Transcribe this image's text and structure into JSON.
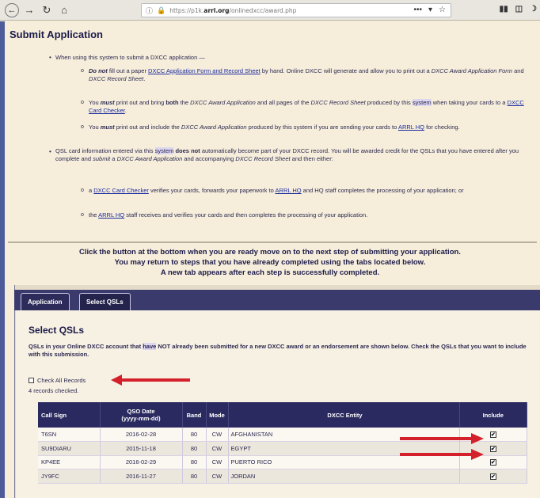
{
  "browser": {
    "url_prefix": "https://p1k.",
    "url_domain": "arrl.org",
    "url_suffix": "/onlinedxcc/award.php",
    "more_glyph": "•••",
    "pocket_glyph": "▾",
    "star_glyph": "☆"
  },
  "page_title": "Submit Application",
  "bullet1": {
    "intro": "When using this system to submit a DXCC application —",
    "sub1": {
      "em": "Do not",
      "t1": " fill out a paper ",
      "link": "DXCC Application Form and Record Sheet",
      "t2": " by hand. Online DXCC will generate and allow you to print out a ",
      "it1": "DXCC Award Application Form",
      "t3": " and ",
      "it2": "DXCC Record Sheet",
      "t4": "."
    },
    "sub2": {
      "t1": "You ",
      "em": "must",
      "t2": " print out and bring ",
      "bold": "both",
      "t3": " the ",
      "it1": "DXCC Award Application",
      "t4": " and all pages of the ",
      "it2": "DXCC Record Sheet",
      "t5": " produced by this ",
      "hl": "system",
      "t6": " when taking your cards to a ",
      "link": "DXCC Card Checker",
      "t7": "."
    },
    "sub3": {
      "t1": "You ",
      "em": "must",
      "t2": " print out and include the ",
      "it1": "DXCC Award Application",
      "t3": " produced by this system if you are sending your cards to ",
      "link": "ARRL HQ",
      "t4": " for checking."
    }
  },
  "bullet2": {
    "t1": "QSL card information entered via this ",
    "hl": "system",
    "bold": " does not",
    "t2": " automatically become part of your DXCC record. You will be awarded credit for the QSLs that you have entered after you complete and ",
    "it1": "submit",
    "t3": " a ",
    "it2": "DXCC Award Application",
    "t4": " and accompanying ",
    "it3": "DXCC Record Sheet",
    "t5": " and then either:",
    "sub1": {
      "t1": "a ",
      "link1": "DXCC Card Checker",
      "t2": " verifies your cards, forwards your paperwork to ",
      "link2": "ARRL HQ",
      "t3": " and HQ staff completes the processing of your application; or"
    },
    "sub2": {
      "t1": "the ",
      "link": "ARRL HQ",
      "t2": " staff receives and verifies your cards and then completes the processing of your application."
    }
  },
  "instructions": [
    "Click the button at the bottom when you are ready move on to the next step of submitting your application.",
    "You may return to steps that you have already completed using the tabs located below.",
    "A new tab appears after each step is successfully completed."
  ],
  "tabs": [
    "Application",
    "Select QSLs"
  ],
  "select_qsls": {
    "title": "Select QSLs",
    "desc_t1": "QSLs in your Online DXCC account that ",
    "desc_hl": "have",
    "desc_t2": " NOT already been submitted for a new DXCC award or an endorsement are shown below. Check the QSLs that you want to include with this submission.",
    "check_all_label": "Check All Records",
    "records_checked": "4 records checked."
  },
  "table": {
    "headers": {
      "call": "Call Sign",
      "date1": "QSO Date",
      "date2": "(yyyy-mm-dd)",
      "band": "Band",
      "mode": "Mode",
      "entity": "DXCC Entity",
      "include": "Include"
    },
    "rows": [
      {
        "call": "T6SN",
        "date": "2016-02-28",
        "band": "80",
        "mode": "CW",
        "entity": "AFGHANISTAN",
        "mark": "✔"
      },
      {
        "call": "SU9DIARU",
        "date": "2015-11-18",
        "band": "80",
        "mode": "CW",
        "entity": "EGYPT",
        "mark": "✔"
      },
      {
        "call": "KP4EE",
        "date": "2016-02-29",
        "band": "80",
        "mode": "CW",
        "entity": "PUERTO RICO",
        "mark": "✔"
      },
      {
        "call": "JY9FC",
        "date": "2016-11-27",
        "band": "80",
        "mode": "CW",
        "entity": "JORDAN",
        "mark": "✔"
      }
    ]
  },
  "colors": {
    "header_bg": "#2b2a60",
    "arrow": "#d4202a",
    "link": "#1b2b9e"
  }
}
